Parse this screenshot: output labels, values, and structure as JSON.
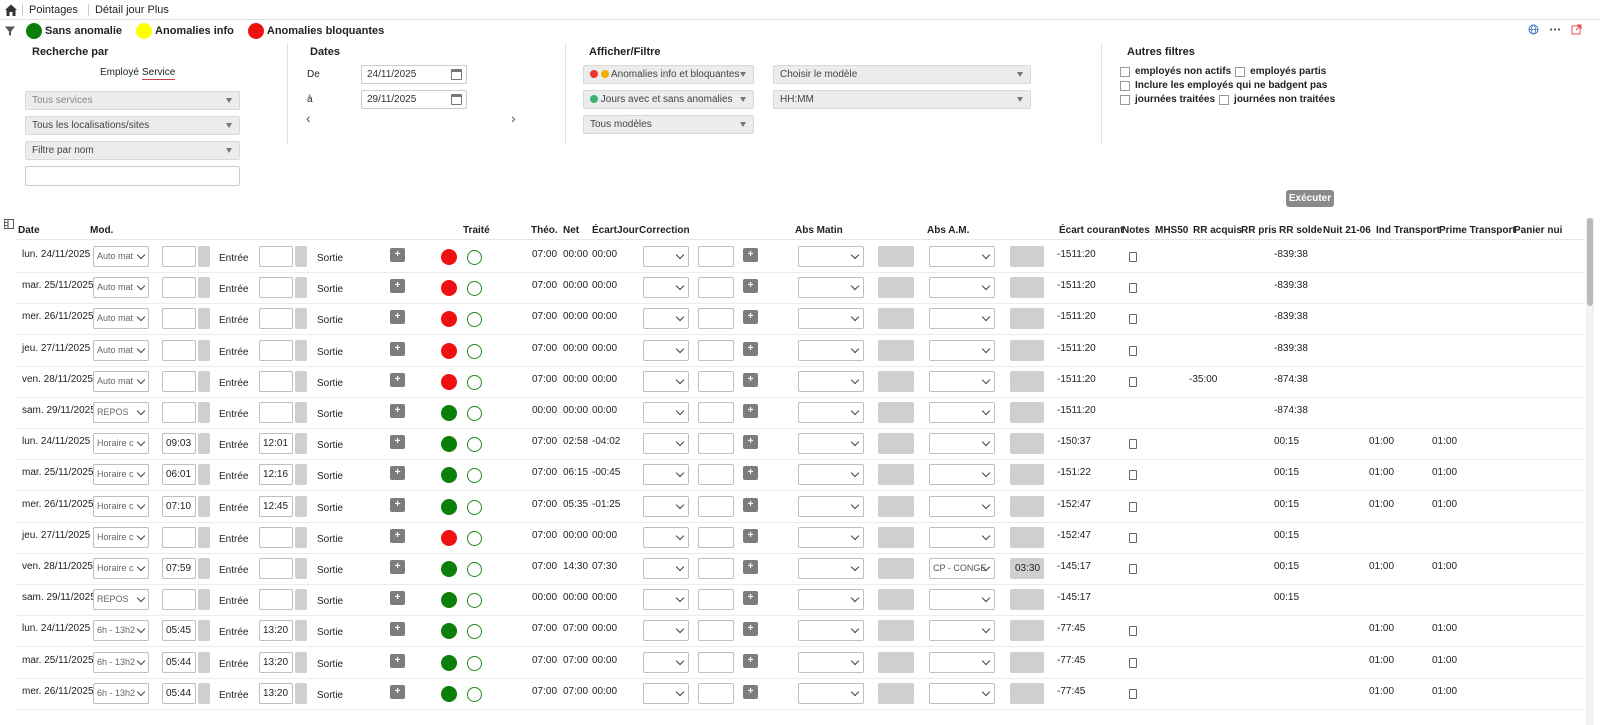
{
  "breadcrumb": [
    "Pointages",
    "Détail jour Plus"
  ],
  "legend": [
    {
      "label": "Sans anomalie",
      "color": "#0a7f0a"
    },
    {
      "label": "Anomalies info",
      "color": "#ffff00"
    },
    {
      "label": "Anomalies bloquantes",
      "color": "#ee1111"
    }
  ],
  "recherche": {
    "title": "Recherche par",
    "toggle_employee": "Employé",
    "toggle_service": "Service",
    "services": "Tous services",
    "locations": "Tous les localisations/sites",
    "name_filter": "Filtre par nom"
  },
  "dates": {
    "title": "Dates",
    "from_label": "De",
    "from_value": "24/11/2025",
    "to_label": "à",
    "to_value": "29/11/2025",
    "prev": "‹",
    "next": "›"
  },
  "afficher": {
    "title": "Afficher/Filtre",
    "anomalies": "Anomalies info et bloquantes",
    "jours": "Jours avec et sans anomalies",
    "modeles": "Tous modèles",
    "choose_model": "Choisir le modèle",
    "format": "HH:MM"
  },
  "autres": {
    "title": "Autres filtres",
    "c1": "employés non actifs",
    "c2": "employés partis",
    "c3": "Inclure les employés qui ne badgent pas",
    "c4": "journées traitées",
    "c5": "journées non traitées"
  },
  "execute_label": "Exécuter",
  "columns": [
    "Date",
    "Mod.",
    "Traité",
    "Théo.",
    "Net",
    "ÉcartJour",
    "Correction",
    "Abs Matin",
    "Abs A.M.",
    "Écart courant",
    "Notes",
    "MHS50",
    "RR acquis",
    "RR pris",
    "RR solde",
    "Nuit 21-06",
    "Ind Transport",
    "Prime Transport",
    "Panier nui"
  ],
  "entree_label": "Entrée",
  "sortie_label": "Sortie",
  "plus_label": "+",
  "rows": [
    {
      "date": "lun. 24/11/2025",
      "mod": "Auto mat",
      "in": "",
      "out": "",
      "status": "red",
      "theo": "07:00",
      "net": "00:00",
      "ecart": "00:00",
      "absam": "",
      "absam_val": "",
      "courant": "-1511:20",
      "note": true,
      "rracq": "",
      "rrsolde": "-839:38",
      "ind": "",
      "prime": ""
    },
    {
      "date": "mar. 25/11/2025",
      "mod": "Auto mat",
      "in": "",
      "out": "",
      "status": "red",
      "theo": "07:00",
      "net": "00:00",
      "ecart": "00:00",
      "absam": "",
      "absam_val": "",
      "courant": "-1511:20",
      "note": true,
      "rracq": "",
      "rrsolde": "-839:38",
      "ind": "",
      "prime": ""
    },
    {
      "date": "mer. 26/11/2025",
      "mod": "Auto mat",
      "in": "",
      "out": "",
      "status": "red",
      "theo": "07:00",
      "net": "00:00",
      "ecart": "00:00",
      "absam": "",
      "absam_val": "",
      "courant": "-1511:20",
      "note": true,
      "rracq": "",
      "rrsolde": "-839:38",
      "ind": "",
      "prime": ""
    },
    {
      "date": "jeu. 27/11/2025",
      "mod": "Auto mat",
      "in": "",
      "out": "",
      "status": "red",
      "theo": "07:00",
      "net": "00:00",
      "ecart": "00:00",
      "absam": "",
      "absam_val": "",
      "courant": "-1511:20",
      "note": true,
      "rracq": "",
      "rrsolde": "-839:38",
      "ind": "",
      "prime": ""
    },
    {
      "date": "ven. 28/11/2025",
      "mod": "Auto mat",
      "in": "",
      "out": "",
      "status": "red",
      "theo": "07:00",
      "net": "00:00",
      "ecart": "00:00",
      "absam": "",
      "absam_val": "",
      "courant": "-1511:20",
      "note": true,
      "rracq": "-35:00",
      "rrsolde": "-874:38",
      "ind": "",
      "prime": ""
    },
    {
      "date": "sam. 29/11/2025",
      "mod": "REPOS",
      "in": "",
      "out": "",
      "status": "green",
      "theo": "00:00",
      "net": "00:00",
      "ecart": "00:00",
      "absam": "",
      "absam_val": "",
      "courant": "-1511:20",
      "note": false,
      "rracq": "",
      "rrsolde": "-874:38",
      "ind": "",
      "prime": ""
    },
    {
      "date": "lun. 24/11/2025",
      "mod": "Horaire c",
      "in": "09:03",
      "out": "12:01",
      "status": "green",
      "theo": "07:00",
      "net": "02:58",
      "ecart": "-04:02",
      "absam": "",
      "absam_val": "",
      "courant": "-150:37",
      "note": true,
      "rracq": "",
      "rrsolde": "00:15",
      "ind": "01:00",
      "prime": "01:00"
    },
    {
      "date": "mar. 25/11/2025",
      "mod": "Horaire c",
      "in": "06:01",
      "out": "12:16",
      "status": "green",
      "theo": "07:00",
      "net": "06:15",
      "ecart": "-00:45",
      "absam": "",
      "absam_val": "",
      "courant": "-151:22",
      "note": true,
      "rracq": "",
      "rrsolde": "00:15",
      "ind": "01:00",
      "prime": "01:00"
    },
    {
      "date": "mer. 26/11/2025",
      "mod": "Horaire c",
      "in": "07:10",
      "out": "12:45",
      "status": "green",
      "theo": "07:00",
      "net": "05:35",
      "ecart": "-01:25",
      "absam": "",
      "absam_val": "",
      "courant": "-152:47",
      "note": true,
      "rracq": "",
      "rrsolde": "00:15",
      "ind": "01:00",
      "prime": "01:00"
    },
    {
      "date": "jeu. 27/11/2025",
      "mod": "Horaire c",
      "in": "",
      "out": "",
      "status": "red",
      "theo": "07:00",
      "net": "00:00",
      "ecart": "00:00",
      "absam": "",
      "absam_val": "",
      "courant": "-152:47",
      "note": true,
      "rracq": "",
      "rrsolde": "00:15",
      "ind": "",
      "prime": ""
    },
    {
      "date": "ven. 28/11/2025",
      "mod": "Horaire c",
      "in": "07:59",
      "out": "",
      "status": "green",
      "theo": "07:00",
      "net": "14:30",
      "ecart": "07:30",
      "absam": "CP - CONGE",
      "absam_val": "03:30",
      "courant": "-145:17",
      "note": true,
      "rracq": "",
      "rrsolde": "00:15",
      "ind": "01:00",
      "prime": "01:00"
    },
    {
      "date": "sam. 29/11/2025",
      "mod": "REPOS",
      "in": "",
      "out": "",
      "status": "green",
      "theo": "00:00",
      "net": "00:00",
      "ecart": "00:00",
      "absam": "",
      "absam_val": "",
      "courant": "-145:17",
      "note": false,
      "rracq": "",
      "rrsolde": "00:15",
      "ind": "",
      "prime": ""
    },
    {
      "date": "lun. 24/11/2025",
      "mod": "6h - 13h2",
      "in": "05:45",
      "out": "13:20",
      "status": "green",
      "theo": "07:00",
      "net": "07:00",
      "ecart": "00:00",
      "absam": "",
      "absam_val": "",
      "courant": "-77:45",
      "note": true,
      "rracq": "",
      "rrsolde": "",
      "ind": "01:00",
      "prime": "01:00"
    },
    {
      "date": "mar. 25/11/2025",
      "mod": "6h - 13h2",
      "in": "05:44",
      "out": "13:20",
      "status": "green",
      "theo": "07:00",
      "net": "07:00",
      "ecart": "00:00",
      "absam": "",
      "absam_val": "",
      "courant": "-77:45",
      "note": true,
      "rracq": "",
      "rrsolde": "",
      "ind": "01:00",
      "prime": "01:00"
    },
    {
      "date": "mer. 26/11/2025",
      "mod": "6h - 13h2",
      "in": "05:44",
      "out": "13:20",
      "status": "green",
      "theo": "07:00",
      "net": "07:00",
      "ecart": "00:00",
      "absam": "",
      "absam_val": "",
      "courant": "-77:45",
      "note": true,
      "rracq": "",
      "rrsolde": "",
      "ind": "01:00",
      "prime": "01:00"
    }
  ]
}
